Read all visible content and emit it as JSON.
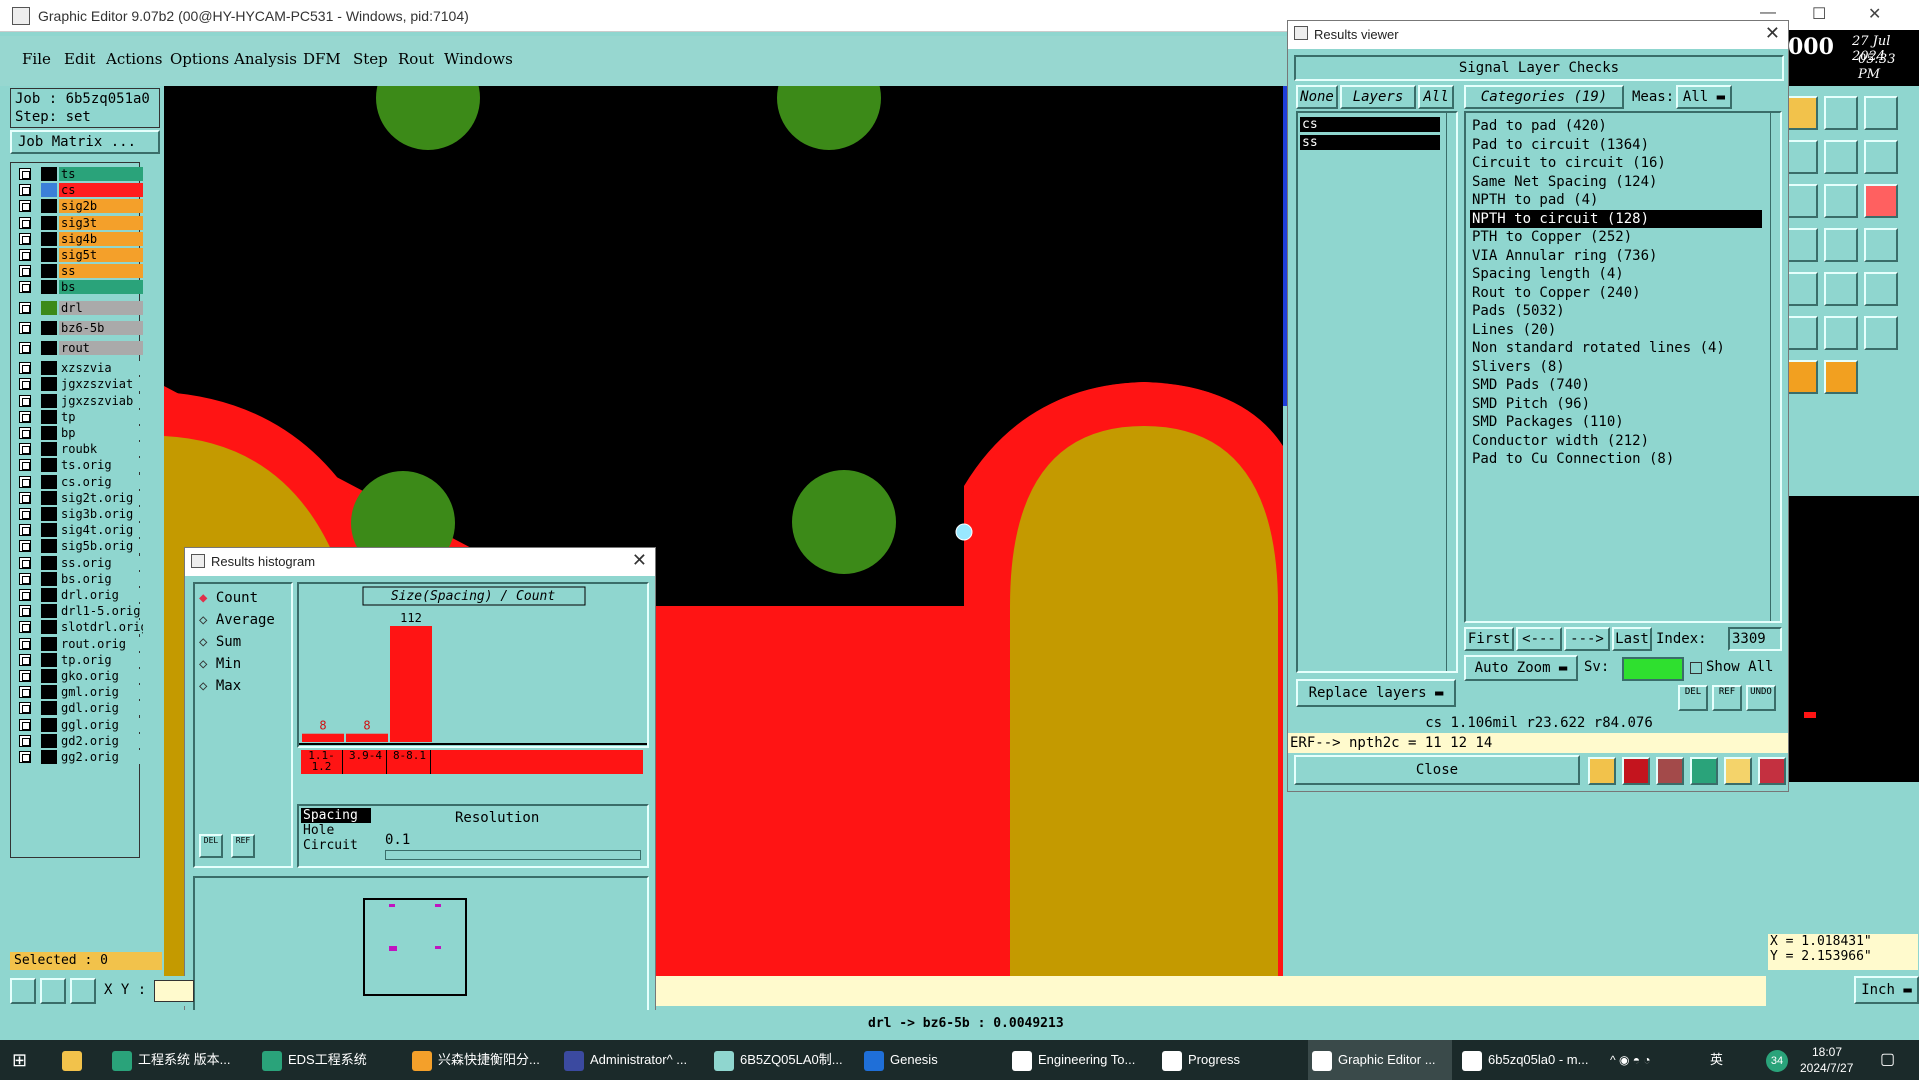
{
  "title_bar": {
    "title": "Graphic Editor 9.07b2 (00@HY-HYCAM-PC531 - Windows, pid:7104)",
    "min": "—",
    "max": "☐",
    "close": "✕"
  },
  "menu": [
    "File",
    "Edit",
    "Actions",
    "Options",
    "Analysis",
    "DFM",
    "Step",
    "Rout",
    "Windows"
  ],
  "clock": {
    "counter": "000",
    "date": "27 Jul 2024",
    "time": "05:33 PM"
  },
  "left_panel": {
    "job": "Job : 6b5zq051a0",
    "step": "Step: set",
    "job_matrix": "Job Matrix ...",
    "layers_group1": [
      {
        "name": "ts",
        "color": "#2aa37a",
        "swatch": "#000000"
      },
      {
        "name": "cs",
        "color": "#ff1e1e",
        "swatch": "#3b7fd8"
      },
      {
        "name": "sig2b",
        "color": "#f4a02a",
        "swatch": "#000000"
      },
      {
        "name": "sig3t",
        "color": "#f4a02a",
        "swatch": "#000000"
      },
      {
        "name": "sig4b",
        "color": "#f4a02a",
        "swatch": "#000000"
      },
      {
        "name": "sig5t",
        "color": "#f4a02a",
        "swatch": "#000000"
      },
      {
        "name": "ss",
        "color": "#f4a02a",
        "swatch": "#000000"
      },
      {
        "name": "bs",
        "color": "#2aa37a",
        "swatch": "#000000"
      }
    ],
    "layer_drl": {
      "name": "drl",
      "color": "#aaaaaa",
      "swatch": "#3c8a18"
    },
    "layer_bz": {
      "name": "bz6-5b",
      "color": "#aaaaaa",
      "swatch": "#000000"
    },
    "layer_rout": {
      "name": "rout",
      "color": "#aaaaaa",
      "swatch": "#000000"
    },
    "layers_group2": [
      "xzszvia",
      "jgxzszviat",
      "jgxzszviab",
      "tp",
      "bp",
      "roubk",
      "ts.orig",
      "cs.orig",
      "sig2t.orig",
      "sig3b.orig",
      "sig4t.orig",
      "sig5b.orig",
      "ss.orig",
      "bs.orig",
      "drl.orig",
      "drl1-5.orig",
      "slotdrl.orig",
      "rout.orig",
      "tp.orig",
      "gko.orig",
      "gml.orig",
      "gdl.orig",
      "ggl.orig",
      "gd2.orig",
      "gg2.orig"
    ],
    "selected": "Selected : 0",
    "xy_label": "X Y :"
  },
  "results_viewer": {
    "title": "Results viewer",
    "header": "Signal Layer Checks",
    "none_btn": "None",
    "layers_btn": "Layers",
    "all_btn": "All",
    "layers": [
      "cs",
      "ss"
    ],
    "categories_title": "Categories (19)",
    "meas_label": "Meas:",
    "meas_value": "All",
    "categories": [
      "Pad to pad (420)",
      "Pad to circuit (1364)",
      "Circuit to circuit (16)",
      "Same Net Spacing (124)",
      "NPTH to pad (4)",
      "NPTH to circuit (128)",
      "PTH to Copper (252)",
      "VIA Annular ring (736)",
      "Spacing length (4)",
      "Rout to Copper (240)",
      "Pads (5032)",
      "Lines (20)",
      "Non standard rotated lines (4)",
      "Slivers (8)",
      "SMD Pads (740)",
      "SMD Pitch (96)",
      "SMD Packages (110)",
      "Conductor width (212)",
      "Pad to Cu Connection (8)"
    ],
    "selected_index": 5,
    "nav": {
      "first": "First",
      "prev": "<---",
      "next": "--->",
      "last": "Last",
      "index_label": "Index:",
      "index_value": "3309"
    },
    "auto_zoom": "Auto Zoom",
    "sv_label": "Sv:",
    "show_all": "Show All",
    "replace_layers": "Replace layers",
    "del": "DEL",
    "ref": "REF",
    "undo": "UNDO",
    "measure_line": "cs 1.106mil  r23.622  r84.076",
    "erf_line": "ERF--> npth2c = 11 12 14",
    "close": "Close"
  },
  "histogram": {
    "title": "Results histogram",
    "options": [
      "Count",
      "Average",
      "Sum",
      "Min",
      "Max"
    ],
    "selected_option": 0,
    "del": "DEL",
    "ref": "REF",
    "side_list": [
      "Spacing",
      "Hole",
      "Circuit"
    ],
    "resolution_label": "Resolution",
    "resolution_value": "0.1",
    "chart_data": {
      "type": "bar",
      "title": "Size(Spacing) / Count",
      "categories": [
        "1.1-1.2",
        "3.9-4",
        "8-8.1"
      ],
      "values": [
        8,
        8,
        112
      ],
      "ylim": [
        0,
        112
      ]
    }
  },
  "status": {
    "bottom": "drl -> bz6-5b : 0.0049213",
    "coords_x": "X = 1.018431\"",
    "coords_y": "Y = 2.153966\"",
    "unit": "Inch"
  },
  "taskbar": {
    "items": [
      "工程系统  版本...",
      "EDS工程系统",
      "兴森快捷衡阳分...",
      "Administrator^ ...",
      "6B5ZQ05LA0制...",
      "Genesis",
      "Engineering To...",
      "Progress",
      "Graphic Editor ...",
      "6b5zq05la0 - m..."
    ],
    "active_index": 8,
    "time": "18:07",
    "date": "2024/7/27",
    "ime": "英",
    "badge": "34"
  },
  "colors": {
    "bg": "#8fd6cf",
    "red": "#ff1414",
    "gold": "#c49a00",
    "green": "#3c8a18",
    "blue": "#1f3fd8",
    "highlight": "#000000"
  }
}
